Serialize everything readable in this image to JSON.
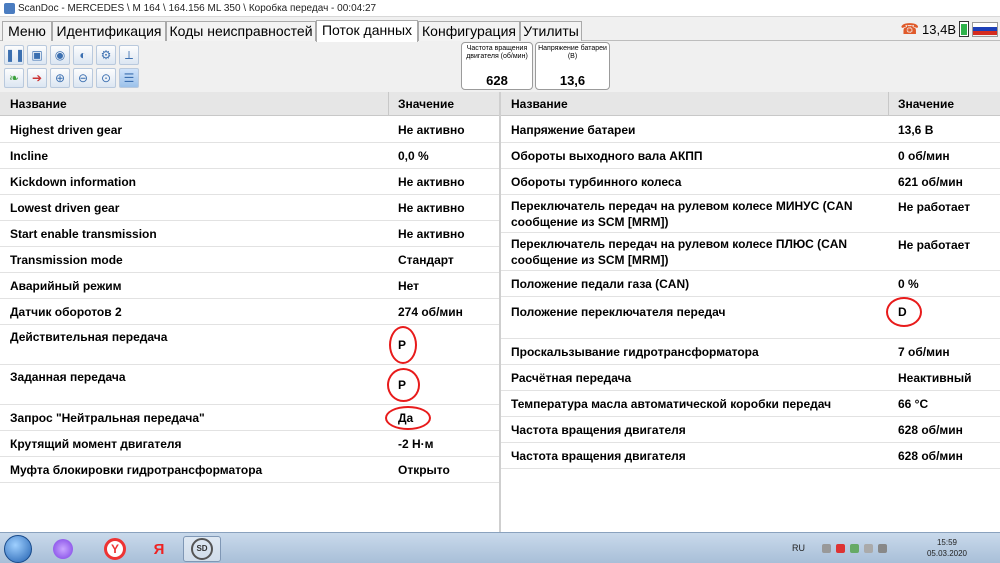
{
  "window": {
    "title": "ScanDoc - MERCEDES \\ M 164 \\ 164.156 ML 350 \\ Коробка передач - 00:04:27"
  },
  "tabs": [
    {
      "label": "Меню"
    },
    {
      "label": "Идентификация"
    },
    {
      "label": "Коды неисправностей"
    },
    {
      "label": "Поток данных"
    },
    {
      "label": "Конфигурация"
    },
    {
      "label": "Утилиты"
    }
  ],
  "status": {
    "voltage": "13,4В",
    "phone_icon": "phone-icon",
    "battery_icon": "battery-icon",
    "flag_colors": [
      "#ffffff",
      "#1c3fb8",
      "#d52b1e"
    ]
  },
  "toolbar": {
    "row1_icons": [
      "pause-icon",
      "save-icon",
      "record-icon",
      "playback-icon",
      "folder-settings-icon",
      "graph-icon"
    ],
    "row2_icons": [
      "leaf-icon",
      "export-icon",
      "zoom-in-icon",
      "zoom-out-icon",
      "zoom-reset-icon",
      "list-icon"
    ]
  },
  "gauges": [
    {
      "title": "Частота вращения двигателя  (об/мин)",
      "value": "628"
    },
    {
      "title": "Напряжение батареи (В)",
      "value": "13,6"
    }
  ],
  "left_table": {
    "col_name": "Название",
    "col_value": "Значение",
    "rows": [
      {
        "name": "Highest driven gear",
        "value": "Не активно"
      },
      {
        "name": "Incline",
        "value": "0,0 %"
      },
      {
        "name": "Kickdown information",
        "value": "Не активно"
      },
      {
        "name": "Lowest driven gear",
        "value": "Не активно"
      },
      {
        "name": "Start enable transmission",
        "value": "Не активно"
      },
      {
        "name": "Transmission mode",
        "value": "Стандарт"
      },
      {
        "name": "Аварийный режим",
        "value": "Нет"
      },
      {
        "name": "Датчик оборотов 2",
        "value": "274 об/мин"
      },
      {
        "name": "Действительная передача",
        "value": "P"
      },
      {
        "name": "Заданная передача",
        "value": "P"
      },
      {
        "name": "Запрос \"Нейтральная передача\"",
        "value": "Да"
      },
      {
        "name": "Крутящий момент двигателя",
        "value": "-2 Н·м"
      },
      {
        "name": "Муфта блокировки гидротрансформатора",
        "value": "Открыто"
      }
    ]
  },
  "right_table": {
    "col_name": "Название",
    "col_value": "Значение",
    "rows": [
      {
        "name": "Напряжение батареи",
        "value": "13,6 В"
      },
      {
        "name": "Обороты выходного вала АКПП",
        "value": "0 об/мин"
      },
      {
        "name": "Обороты турбинного колеса",
        "value": "621 об/мин"
      },
      {
        "name": "Переключатель передач на рулевом колесе МИНУС (CAN сообщение из SCM [MRM])",
        "value": "Не работает"
      },
      {
        "name": "Переключатель передач на рулевом колесе ПЛЮС (CAN сообщение из SCM [MRM])",
        "value": "Не работает"
      },
      {
        "name": "Положение педали газа (CAN)",
        "value": "0 %"
      },
      {
        "name": "Положение переключателя передач",
        "value": "D"
      },
      {
        "name": "Проскальзывание гидротрансформатора",
        "value": "7 об/мин"
      },
      {
        "name": "Расчётная передача",
        "value": "Неактивный"
      },
      {
        "name": "Температура масла автоматической коробки передач",
        "value": "66 °C"
      },
      {
        "name": "Частота вращения двигателя",
        "value": "628 об/мин"
      },
      {
        "name": "Частота вращения двигателя",
        "value": "628 об/мин"
      }
    ]
  },
  "taskbar": {
    "apps": [
      "start-orb",
      "alice-icon",
      "yandex-browser-icon",
      "yandex-icon",
      "scandoc-icon"
    ],
    "yandex_letter": "Y",
    "yandex_letter2": "Я",
    "scandoc_label": "SD",
    "lang": "RU",
    "time": "15:59",
    "date": "05.03.2020"
  },
  "colors": {
    "highlight_circle": "#e81b1b",
    "accent": "#3b6fb0"
  }
}
